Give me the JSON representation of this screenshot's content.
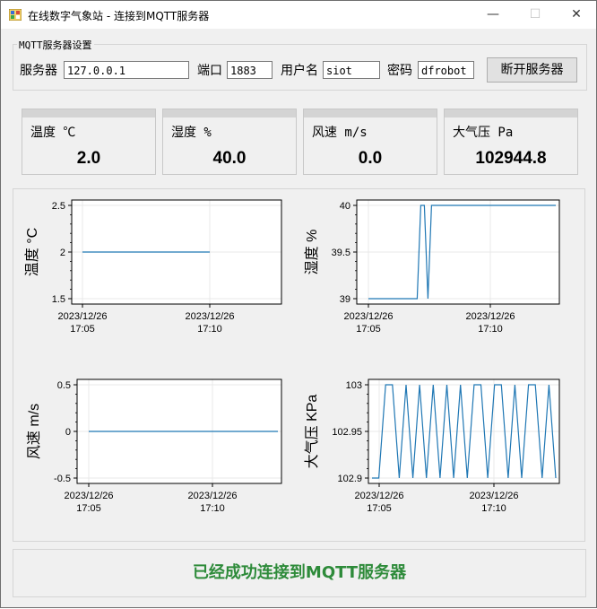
{
  "window": {
    "title": "在线数字气象站 - 连接到MQTT服务器",
    "minimize_glyph": "—",
    "maximize_glyph": "☐",
    "close_glyph": "✕"
  },
  "settings": {
    "legend": "MQTT服务器设置",
    "server_label": "服务器",
    "server_value": "127.0.0.1",
    "port_label": "端口",
    "port_value": "1883",
    "user_label": "用户名",
    "user_value": "siot",
    "password_label": "密码",
    "password_value": "dfrobot",
    "disconnect_label": "断开服务器"
  },
  "cards": [
    {
      "label": "温度 ℃",
      "value": "2.0"
    },
    {
      "label": "湿度 %",
      "value": "40.0"
    },
    {
      "label": "风速 m/s",
      "value": "0.0"
    },
    {
      "label": "大气压 Pa",
      "value": "102944.8"
    }
  ],
  "chart_data": [
    {
      "type": "line",
      "ylabel": "温度 °C",
      "ylim": [
        1.5,
        2.5
      ],
      "yticks": [
        "2.5",
        "2",
        "1.5"
      ],
      "xticks": [
        [
          "2023/12/26",
          "17:05"
        ],
        [
          "2023/12/26",
          "17:10"
        ]
      ],
      "x": [
        "17:05",
        "17:10"
      ],
      "y": [
        2.0,
        2.0
      ],
      "color": "#1f77b4",
      "grid": true
    },
    {
      "type": "line",
      "ylabel": "湿度 %",
      "ylim": [
        39,
        40
      ],
      "yticks": [
        "40",
        "39.5",
        "39"
      ],
      "xticks": [
        [
          "2023/12/26",
          "17:05"
        ],
        [
          "2023/12/26",
          "17:10"
        ]
      ],
      "x": [
        "17:05",
        "17:07",
        "17:07",
        "17:07",
        "17:07",
        "17:07",
        "17:13"
      ],
      "y": [
        39,
        39,
        40,
        40,
        39,
        40,
        40
      ],
      "color": "#1f77b4",
      "grid": true
    },
    {
      "type": "line",
      "ylabel": "风速 m/s",
      "ylim": [
        -0.5,
        0.5
      ],
      "yticks": [
        "0.5",
        "0",
        "-0.5"
      ],
      "xticks": [
        [
          "2023/12/26",
          "17:05"
        ],
        [
          "2023/12/26",
          "17:10"
        ]
      ],
      "x": [
        "17:05",
        "17:13"
      ],
      "y": [
        0,
        0
      ],
      "color": "#1f77b4",
      "grid": true
    },
    {
      "type": "line",
      "ylabel": "大气压 KPa",
      "ylim": [
        102.9,
        103
      ],
      "yticks": [
        "103",
        "102.95",
        "102.9"
      ],
      "xticks": [
        [
          "2023/12/26",
          "17:05"
        ],
        [
          "2023/12/26",
          "17:10"
        ]
      ],
      "x_start": "17:05",
      "x_end": "17:13",
      "y": [
        102.9,
        102.9,
        103,
        103,
        102.9,
        103,
        102.9,
        103,
        102.9,
        103,
        102.9,
        103,
        102.9,
        103,
        102.9,
        103,
        103,
        102.9,
        103,
        103,
        102.9,
        103,
        102.9,
        103,
        103,
        102.9,
        103,
        102.9
      ],
      "color": "#1f77b4",
      "grid": true
    }
  ],
  "status": "已经成功连接到MQTT服务器"
}
